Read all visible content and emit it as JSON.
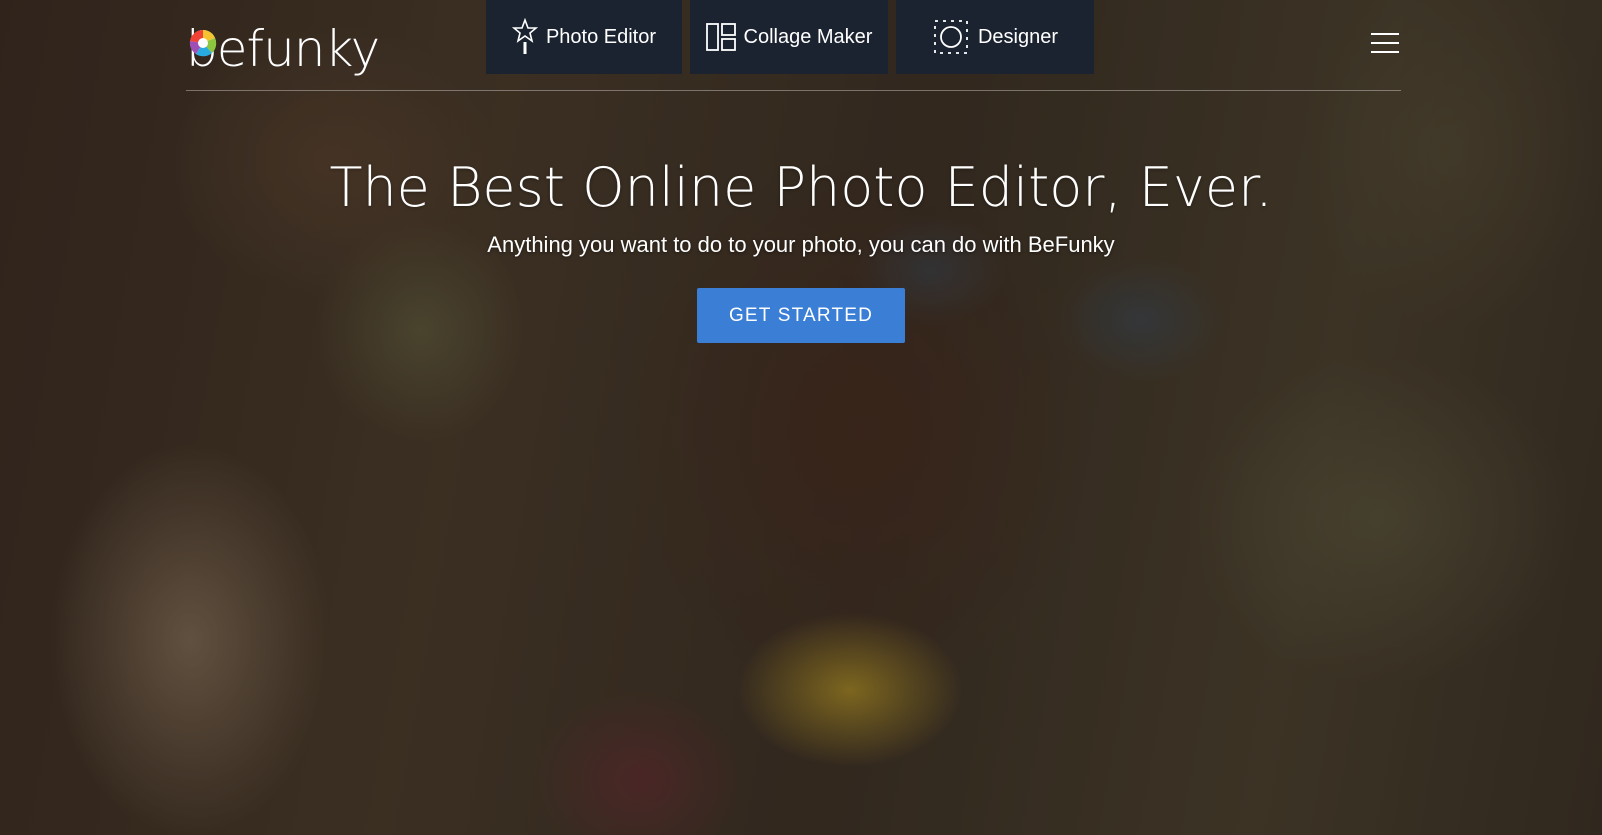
{
  "brand": {
    "logo_text": "befunky"
  },
  "nav": {
    "items": [
      {
        "label": "Photo Editor",
        "icon": "magic-wand-star-icon"
      },
      {
        "label": "Collage Maker",
        "icon": "collage-grid-icon"
      },
      {
        "label": "Designer",
        "icon": "designer-circle-icon"
      }
    ],
    "menu_icon": "hamburger-menu-icon"
  },
  "hero": {
    "title": "The Best Online Photo Editor, Ever.",
    "subtitle": "Anything you want to do to your photo, you can do with BeFunky",
    "cta_label": "GET STARTED",
    "background_image": "woman-holding-gold-camera-photo"
  },
  "colors": {
    "nav_background": "#1b2331",
    "cta_background": "#3a7fd5",
    "text": "#ffffff"
  }
}
